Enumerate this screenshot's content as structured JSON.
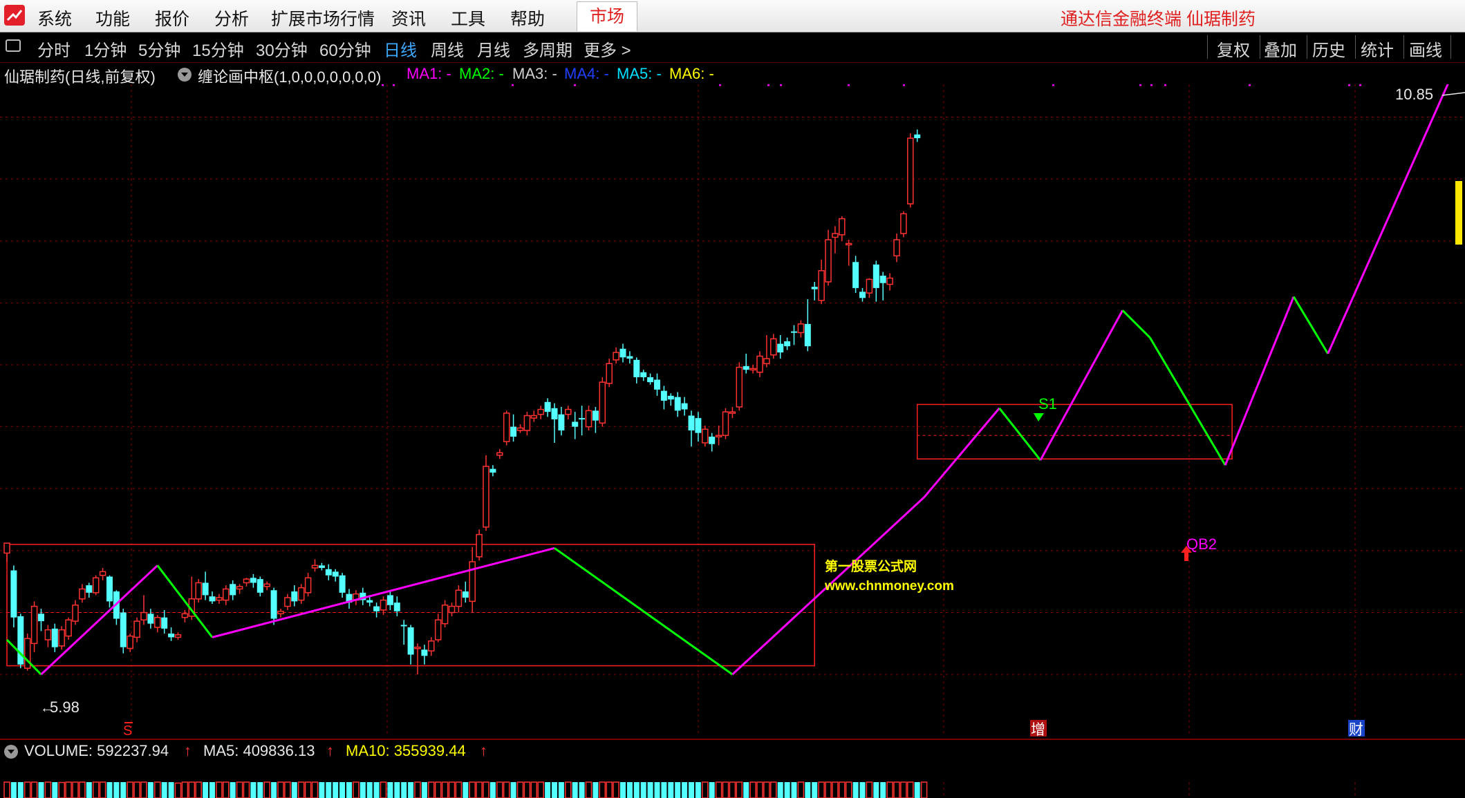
{
  "menu": {
    "items": [
      "系统",
      "功能",
      "报价",
      "分析",
      "扩展市场行情",
      "资讯",
      "工具",
      "帮助"
    ],
    "market_tab": "市场",
    "brand": "通达信金融终端  仙琚制药"
  },
  "toolbar": {
    "periods": [
      "分时",
      "1分钟",
      "5分钟",
      "15分钟",
      "30分钟",
      "60分钟",
      "日线",
      "周线",
      "月线",
      "多周期",
      "更多 >"
    ],
    "active": "日线",
    "right_buttons": [
      "复权",
      "叠加",
      "历史",
      "统计",
      "画线"
    ]
  },
  "legend": {
    "title": "仙琚制药(日线,前复权)",
    "indicator": "缠论画中枢(1,0,0,0,0,0,0,0)",
    "ma": [
      {
        "label": "MA1: -",
        "color": "#ff00ff"
      },
      {
        "label": "MA2: -",
        "color": "#00ff00"
      },
      {
        "label": "MA3: -",
        "color": "#d0d0d0"
      },
      {
        "label": "MA4: -",
        "color": "#2040ff"
      },
      {
        "label": "MA5: -",
        "color": "#00e0ff"
      },
      {
        "label": "MA6: -",
        "color": "#ffff00"
      }
    ]
  },
  "volume_legend": {
    "volume": "VOLUME: 592237.94",
    "ma5": "MA5: 409836.13",
    "ma10": "MA10: 355939.44"
  },
  "watermark": {
    "line1": "第一股票公式网",
    "line2": "www.chnmoney.com"
  },
  "chart_data": {
    "type": "candlestick",
    "price_low_label": "5.98",
    "price_high_label": "10.85",
    "ylim": [
      5.8,
      11.1
    ],
    "annotations": {
      "s1": "S1",
      "qb2": "QB2",
      "marker_s": "S",
      "marker_zeng": "增",
      "marker_cai": "财"
    },
    "colors": {
      "up": "#ff3232",
      "down": "#54ffff",
      "stroke_up": "#ff00ff",
      "stroke_down": "#00ff00",
      "grid": "#8a0000",
      "box": "#ff2020"
    },
    "candles": [
      [
        6.98,
        7.06,
        6.91,
        7.04
      ],
      [
        6.84,
        6.46,
        6.38,
        6.88
      ],
      [
        6.47,
        6.08,
        6.05,
        6.49
      ],
      [
        6.05,
        6.29,
        6.03,
        6.33
      ],
      [
        6.25,
        6.55,
        6.18,
        6.59
      ],
      [
        6.49,
        6.43,
        6.35,
        6.53
      ],
      [
        6.28,
        6.36,
        6.22,
        6.4
      ],
      [
        6.37,
        6.22,
        6.18,
        6.41
      ],
      [
        6.23,
        6.36,
        6.2,
        6.39
      ],
      [
        6.31,
        6.44,
        6.28,
        6.46
      ],
      [
        6.43,
        6.56,
        6.4,
        6.6
      ],
      [
        6.61,
        6.69,
        6.58,
        6.73
      ],
      [
        6.72,
        6.66,
        6.62,
        6.74
      ],
      [
        6.66,
        6.78,
        6.64,
        6.8
      ],
      [
        6.8,
        6.83,
        6.76,
        6.86
      ],
      [
        6.79,
        6.59,
        6.54,
        6.8
      ],
      [
        6.67,
        6.45,
        6.4,
        6.68
      ],
      [
        6.5,
        6.22,
        6.17,
        6.53
      ],
      [
        6.21,
        6.31,
        6.18,
        6.33
      ],
      [
        6.3,
        6.43,
        6.26,
        6.46
      ],
      [
        6.44,
        6.5,
        6.4,
        6.64
      ],
      [
        6.49,
        6.41,
        6.37,
        6.53
      ],
      [
        6.38,
        6.46,
        6.34,
        6.48
      ],
      [
        6.46,
        6.37,
        6.33,
        6.52
      ],
      [
        6.33,
        6.3,
        6.27,
        6.38
      ],
      [
        6.3,
        6.32,
        6.28,
        6.34
      ],
      [
        6.46,
        6.49,
        6.42,
        6.52
      ],
      [
        6.47,
        6.61,
        6.44,
        6.79
      ],
      [
        6.61,
        6.74,
        6.58,
        6.77
      ],
      [
        6.74,
        6.64,
        6.6,
        6.83
      ],
      [
        6.63,
        6.59,
        6.57,
        6.67
      ],
      [
        6.6,
        6.62,
        6.57,
        6.65
      ],
      [
        6.6,
        6.69,
        6.56,
        6.72
      ],
      [
        6.73,
        6.64,
        6.6,
        6.76
      ],
      [
        6.69,
        6.71,
        6.65,
        6.73
      ],
      [
        6.74,
        6.77,
        6.71,
        6.78
      ],
      [
        6.78,
        6.74,
        6.7,
        6.81
      ],
      [
        6.77,
        6.66,
        6.63,
        6.79
      ],
      [
        6.71,
        6.73,
        6.68,
        6.75
      ],
      [
        6.68,
        6.45,
        6.4,
        6.7
      ],
      [
        6.49,
        6.51,
        6.46,
        6.53
      ],
      [
        6.55,
        6.62,
        6.52,
        6.65
      ],
      [
        6.67,
        6.59,
        6.55,
        6.72
      ],
      [
        6.6,
        6.7,
        6.57,
        6.73
      ],
      [
        6.66,
        6.78,
        6.63,
        6.82
      ],
      [
        6.86,
        6.88,
        6.83,
        6.93
      ],
      [
        6.88,
        6.86,
        6.84,
        6.9
      ],
      [
        6.85,
        6.8,
        6.76,
        6.89
      ],
      [
        6.83,
        6.79,
        6.75,
        6.85
      ],
      [
        6.8,
        6.66,
        6.62,
        6.82
      ],
      [
        6.65,
        6.58,
        6.53,
        6.69
      ],
      [
        6.6,
        6.65,
        6.56,
        6.68
      ],
      [
        6.66,
        6.6,
        6.56,
        6.7
      ],
      [
        6.6,
        6.58,
        6.55,
        6.64
      ],
      [
        6.55,
        6.51,
        6.46,
        6.58
      ],
      [
        6.52,
        6.6,
        6.48,
        6.63
      ],
      [
        6.64,
        6.56,
        6.52,
        6.67
      ],
      [
        6.58,
        6.51,
        6.47,
        6.63
      ],
      [
        6.4,
        6.39,
        6.24,
        6.44
      ],
      [
        6.38,
        6.16,
        6.08,
        6.4
      ],
      [
        6.22,
        6.22,
        6.0,
        6.25
      ],
      [
        6.2,
        6.15,
        6.08,
        6.24
      ],
      [
        6.19,
        6.27,
        6.15,
        6.3
      ],
      [
        6.28,
        6.44,
        6.26,
        6.49
      ],
      [
        6.41,
        6.56,
        6.38,
        6.6
      ],
      [
        6.5,
        6.55,
        6.47,
        6.58
      ],
      [
        6.55,
        6.68,
        6.5,
        6.72
      ],
      [
        6.67,
        6.62,
        6.58,
        6.75
      ],
      [
        6.59,
        6.91,
        6.5,
        7.03
      ],
      [
        6.95,
        7.13,
        6.92,
        7.17
      ],
      [
        7.19,
        7.68,
        7.16,
        7.77
      ],
      [
        7.66,
        7.63,
        7.6,
        7.69
      ],
      [
        7.77,
        7.79,
        7.74,
        7.82
      ],
      [
        7.88,
        8.11,
        7.85,
        8.13
      ],
      [
        8.0,
        7.92,
        7.88,
        8.1
      ],
      [
        7.97,
        7.99,
        7.95,
        8.02
      ],
      [
        7.97,
        8.09,
        7.93,
        8.12
      ],
      [
        8.07,
        8.09,
        8.04,
        8.13
      ],
      [
        8.1,
        8.14,
        8.06,
        8.17
      ],
      [
        8.2,
        8.12,
        8.08,
        8.23
      ],
      [
        8.15,
        8.06,
        7.87,
        8.19
      ],
      [
        8.1,
        7.97,
        7.93,
        8.16
      ],
      [
        8.1,
        8.14,
        8.06,
        8.17
      ],
      [
        8.04,
        8.0,
        7.9,
        8.12
      ],
      [
        8.07,
        8.06,
        7.93,
        8.17
      ],
      [
        8.0,
        8.13,
        7.97,
        8.17
      ],
      [
        8.13,
        8.05,
        7.95,
        8.16
      ],
      [
        8.03,
        8.36,
        8.0,
        8.4
      ],
      [
        8.35,
        8.51,
        8.32,
        8.55
      ],
      [
        8.54,
        8.6,
        8.51,
        8.64
      ],
      [
        8.63,
        8.56,
        8.52,
        8.67
      ],
      [
        8.57,
        8.55,
        8.51,
        8.61
      ],
      [
        8.54,
        8.4,
        8.35,
        8.56
      ],
      [
        8.44,
        8.4,
        8.37,
        8.46
      ],
      [
        8.4,
        8.36,
        8.34,
        8.43
      ],
      [
        8.38,
        8.3,
        8.25,
        8.43
      ],
      [
        8.29,
        8.21,
        8.14,
        8.33
      ],
      [
        8.25,
        8.22,
        8.17,
        8.27
      ],
      [
        8.24,
        8.13,
        8.08,
        8.28
      ],
      [
        8.19,
        8.14,
        8.09,
        8.24
      ],
      [
        8.09,
        7.97,
        7.84,
        8.13
      ],
      [
        8.07,
        7.95,
        7.88,
        8.12
      ],
      [
        7.87,
        7.98,
        7.84,
        8.01
      ],
      [
        7.92,
        7.86,
        7.8,
        7.95
      ],
      [
        7.93,
        7.93,
        7.85,
        8.01
      ],
      [
        7.93,
        8.12,
        7.9,
        8.15
      ],
      [
        8.11,
        8.12,
        8.07,
        8.16
      ],
      [
        8.16,
        8.48,
        8.13,
        8.52
      ],
      [
        8.49,
        8.46,
        8.43,
        8.59
      ],
      [
        8.46,
        8.47,
        8.43,
        8.5
      ],
      [
        8.44,
        8.57,
        8.4,
        8.61
      ],
      [
        8.51,
        8.55,
        8.48,
        8.74
      ],
      [
        8.58,
        8.71,
        8.55,
        8.75
      ],
      [
        8.67,
        8.6,
        8.55,
        8.74
      ],
      [
        8.69,
        8.65,
        8.62,
        8.72
      ],
      [
        8.77,
        8.76,
        8.66,
        8.82
      ],
      [
        8.76,
        8.83,
        8.72,
        8.86
      ],
      [
        8.83,
        8.65,
        8.61,
        9.03
      ],
      [
        9.13,
        9.11,
        9.02,
        9.17
      ],
      [
        9.02,
        9.26,
        8.99,
        9.35
      ],
      [
        9.17,
        9.51,
        9.14,
        9.59
      ],
      [
        9.53,
        9.56,
        9.4,
        9.62
      ],
      [
        9.55,
        9.68,
        9.5,
        9.7
      ],
      [
        9.48,
        9.48,
        9.3,
        9.51
      ],
      [
        9.33,
        9.12,
        9.08,
        9.38
      ],
      [
        9.09,
        9.04,
        9.01,
        9.12
      ],
      [
        9.08,
        9.19,
        9.04,
        9.2
      ],
      [
        9.31,
        9.12,
        9.01,
        9.34
      ],
      [
        9.22,
        9.16,
        9.02,
        9.25
      ],
      [
        9.15,
        9.2,
        9.1,
        9.24
      ],
      [
        9.38,
        9.51,
        9.33,
        9.56
      ],
      [
        9.56,
        9.72,
        9.53,
        9.74
      ],
      [
        9.8,
        10.33,
        9.77,
        10.37
      ],
      [
        10.36,
        10.33,
        10.3,
        10.4
      ]
    ],
    "strokes": [
      [
        0,
        6.28
      ],
      [
        5,
        6.0
      ],
      [
        22,
        6.88
      ],
      [
        30,
        6.3
      ],
      [
        80,
        7.02
      ],
      [
        106,
        6.0
      ],
      [
        134,
        7.43
      ],
      [
        145,
        8.15
      ],
      [
        151,
        7.73
      ],
      [
        163,
        8.94
      ],
      [
        167,
        8.72
      ],
      [
        178,
        7.69
      ],
      [
        188,
        9.05
      ],
      [
        193,
        8.59
      ],
      [
        212,
        10.95
      ]
    ],
    "boxes": [
      {
        "i0": 0,
        "i1": 118,
        "top": 7.05,
        "bottom": 6.07,
        "mid": 6.5
      },
      {
        "i0": 133,
        "i1": 179,
        "top": 8.18,
        "bottom": 7.74,
        "mid": 7.93
      }
    ],
    "volume_bars": [
      52,
      38,
      45,
      70,
      40,
      28,
      30,
      34,
      25,
      30,
      38,
      44,
      36,
      40,
      46,
      58,
      50,
      70,
      42,
      38,
      45,
      30,
      36,
      28,
      26,
      24,
      40,
      62,
      50,
      44,
      35,
      32,
      38,
      30,
      30,
      34,
      28,
      36,
      30,
      52,
      34,
      40,
      30,
      36,
      48,
      52,
      30,
      36,
      28,
      50,
      40,
      32,
      34,
      28,
      40,
      32,
      30,
      36,
      54,
      62,
      60,
      40,
      44,
      52,
      58,
      44,
      54,
      40,
      72,
      78,
      86,
      50,
      46,
      60,
      52,
      36,
      38,
      34,
      40,
      46,
      54,
      44,
      38,
      50,
      42,
      46,
      40,
      68,
      70,
      56,
      46,
      40,
      58,
      42,
      38,
      46,
      52,
      40,
      44,
      40,
      58,
      62,
      48,
      50,
      40,
      60,
      44,
      66,
      50,
      40,
      48,
      54,
      50,
      42,
      40,
      48,
      44,
      60,
      70,
      74,
      80,
      60,
      54,
      62,
      70,
      48,
      40,
      44,
      46,
      40,
      50,
      74,
      62,
      90,
      82
    ]
  }
}
